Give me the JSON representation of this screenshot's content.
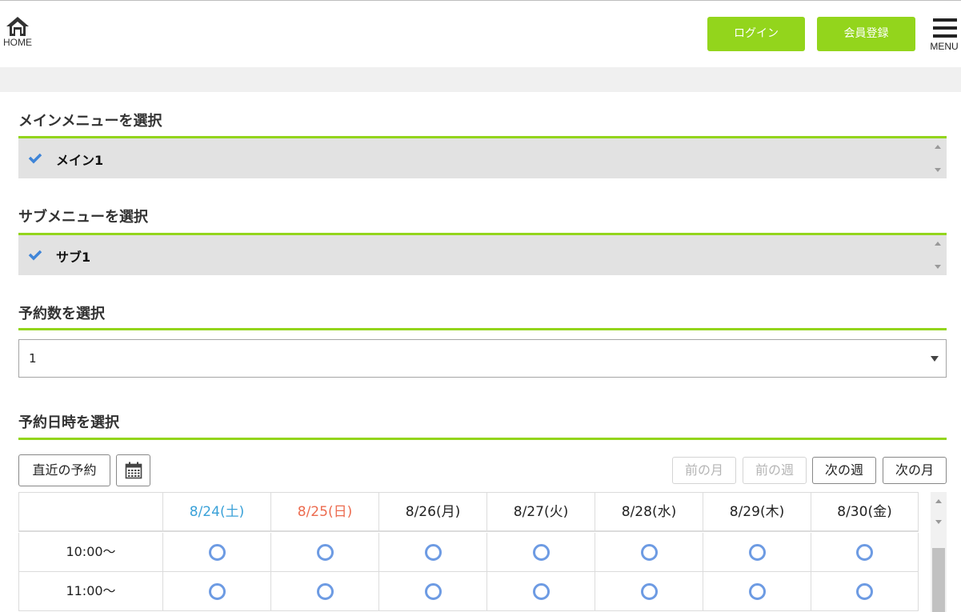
{
  "header": {
    "home_label": "HOME",
    "login_label": "ログイン",
    "register_label": "会員登録",
    "menu_label": "MENU",
    "accent_color": "#93d51c"
  },
  "main_menu": {
    "title": "メインメニューを選択",
    "selected": "メイン1"
  },
  "sub_menu": {
    "title": "サブメニューを選択",
    "selected": "サブ1"
  },
  "count": {
    "title": "予約数を選択",
    "value": "1"
  },
  "datetime": {
    "title": "予約日時を選択",
    "recent_label": "直近の予約",
    "prev_month": "前の月",
    "prev_week": "前の週",
    "next_week": "次の週",
    "next_month": "次の月",
    "days": [
      "8/24(土)",
      "8/25(日)",
      "8/26(月)",
      "8/27(火)",
      "8/28(水)",
      "8/29(木)",
      "8/30(金)"
    ],
    "times": [
      "10:00〜",
      "11:00〜"
    ],
    "availability_icon": "circle-available-icon"
  }
}
